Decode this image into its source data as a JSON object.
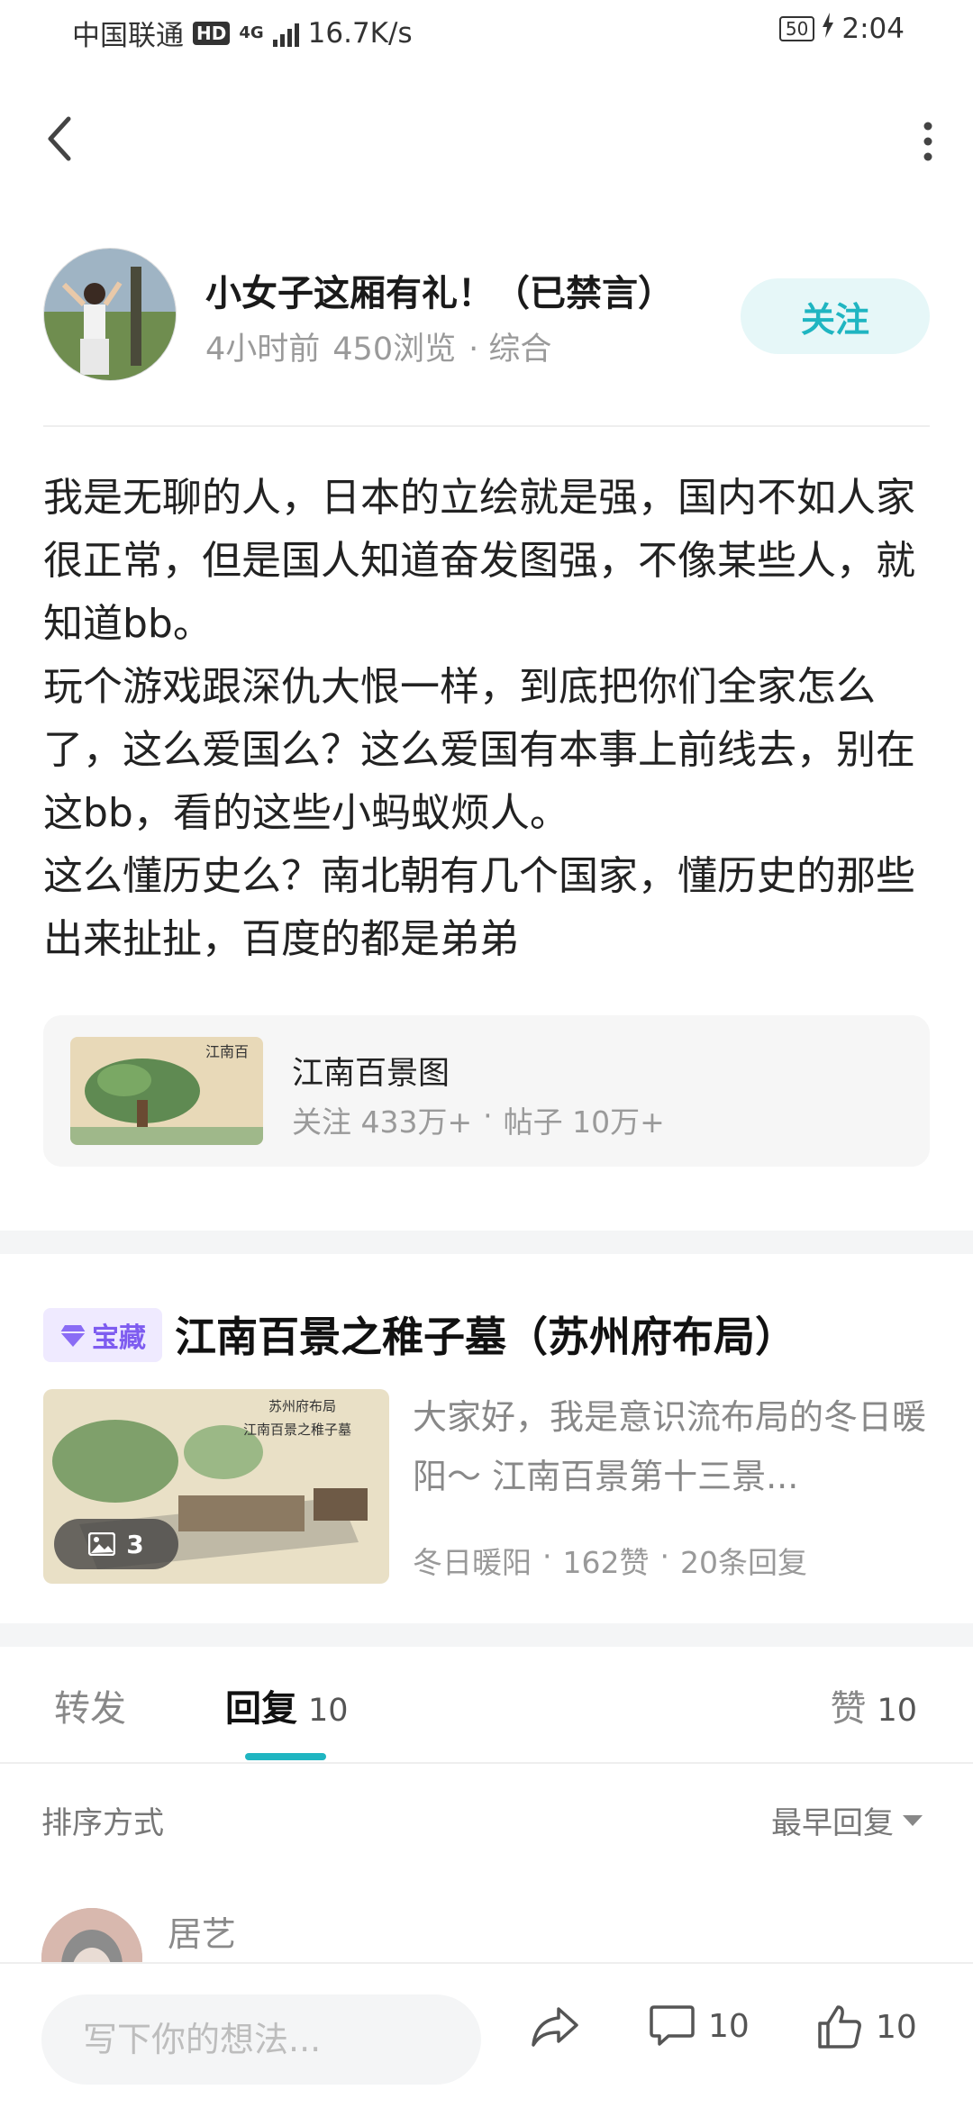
{
  "status_bar": {
    "carrier": "中国联通",
    "hd": "HD",
    "network": "4G",
    "speed": "16.7K/s",
    "battery": "50",
    "time": "2:04"
  },
  "nav": {
    "back_icon": "chevron-left-icon",
    "more_icon": "more-vertical-icon"
  },
  "author": {
    "name": "小女子这厢有礼！（已禁言）",
    "time": "4小时前",
    "views": "450浏览",
    "category": "· 综合",
    "follow_label": "关注"
  },
  "post": {
    "paragraphs": [
      "我是无聊的人，日本的立绘就是强，国内不如人家很正常，但是国人知道奋发图强，不像某些人，就知道bb。",
      "玩个游戏跟深仇大恨一样，到底把你们全家怎么了，这么爱国么？这么爱国有本事上前线去，别在这bb，看的这些小蚂蚁烦人。",
      "这么懂历史么？南北朝有几个国家，懂历史的那些出来扯扯，百度的都是弟弟"
    ]
  },
  "topic": {
    "title": "江南百景图",
    "followers": "关注 433万+",
    "sep": "·",
    "posts": "帖子 10万+",
    "thumb_text": "江南百"
  },
  "related": {
    "badge": "宝藏",
    "title": "江南百景之稚子墓（苏州府布局）",
    "excerpt": "大家好，我是意识流布局的冬日暖阳～ 江南百景第十三景...",
    "image_count": "3",
    "author": "冬日暖阳",
    "likes": "162赞",
    "replies": "20条回复",
    "sep": "·",
    "thumb_caption_1": "苏州府布局",
    "thumb_caption_2": "江南百景之稚子墓"
  },
  "tabs": {
    "forward": "转发",
    "reply": "回复",
    "reply_count": "10",
    "like": "赞",
    "like_count": "10"
  },
  "sort": {
    "label": "排序方式",
    "selected": "最早回复"
  },
  "comments": [
    {
      "name": "居艺"
    }
  ],
  "bottom_bar": {
    "placeholder": "写下你的想法...",
    "comment_count": "10",
    "like_count": "10"
  },
  "colors": {
    "accent": "#1fb5c1",
    "badge_purple": "#7e5cf0",
    "follow_bg": "#e6f7f8"
  }
}
